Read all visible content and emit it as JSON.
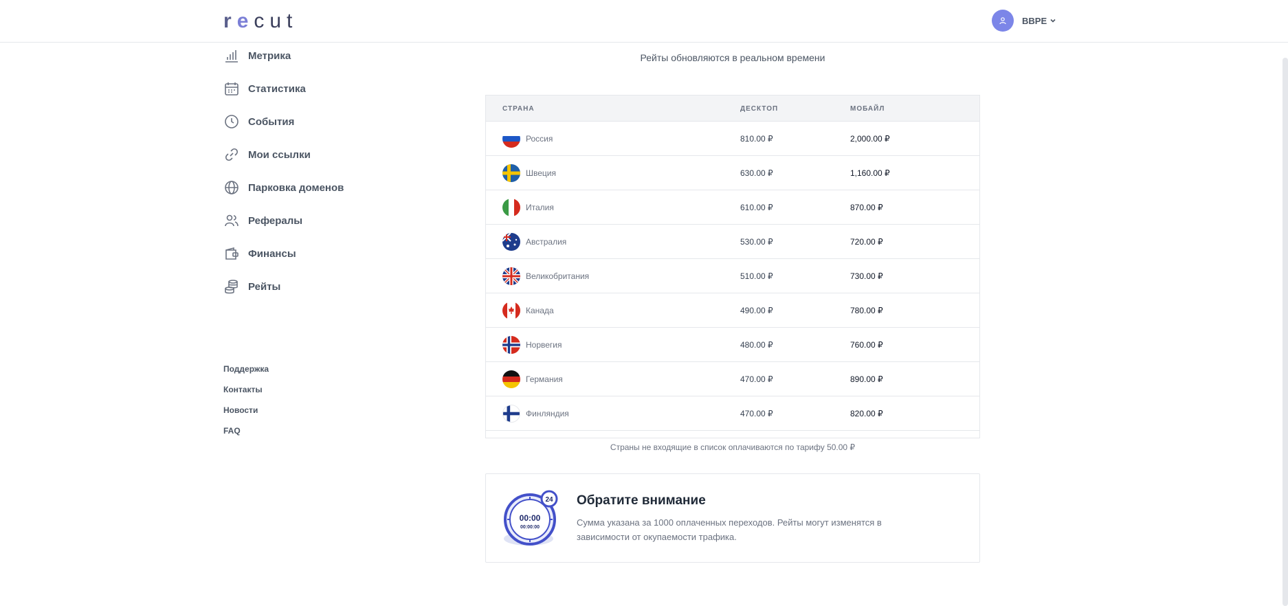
{
  "header": {
    "logo": [
      "r",
      "e",
      "cut"
    ],
    "user_name": "BBPE"
  },
  "sidebar": {
    "items": [
      {
        "label": "Метрика",
        "icon": "bar-chart-icon"
      },
      {
        "label": "Статистика",
        "icon": "calendar-icon"
      },
      {
        "label": "События",
        "icon": "clock-icon"
      },
      {
        "label": "Мои ссылки",
        "icon": "link-icon"
      },
      {
        "label": "Парковка доменов",
        "icon": "globe-icon"
      },
      {
        "label": "Рефералы",
        "icon": "users-icon"
      },
      {
        "label": "Финансы",
        "icon": "wallet-icon"
      },
      {
        "label": "Рейты",
        "icon": "coins-icon"
      }
    ],
    "footer_links": [
      "Поддержка",
      "Контакты",
      "Новости",
      "FAQ"
    ]
  },
  "main": {
    "subtitle": "Рейты обновляются в реальном времени",
    "table": {
      "columns": [
        "СТРАНА",
        "ДЕСКТОП",
        "МОБАЙЛ"
      ],
      "rows": [
        {
          "country": "Россия",
          "desktop": "810.00 ₽",
          "mobile": "2,000.00 ₽",
          "flag": "ru"
        },
        {
          "country": "Швеция",
          "desktop": "630.00 ₽",
          "mobile": "1,160.00 ₽",
          "flag": "se"
        },
        {
          "country": "Италия",
          "desktop": "610.00 ₽",
          "mobile": "870.00 ₽",
          "flag": "it"
        },
        {
          "country": "Австралия",
          "desktop": "530.00 ₽",
          "mobile": "720.00 ₽",
          "flag": "au"
        },
        {
          "country": "Великобритания",
          "desktop": "510.00 ₽",
          "mobile": "730.00 ₽",
          "flag": "gb"
        },
        {
          "country": "Канада",
          "desktop": "490.00 ₽",
          "mobile": "780.00 ₽",
          "flag": "ca"
        },
        {
          "country": "Норвегия",
          "desktop": "480.00 ₽",
          "mobile": "760.00 ₽",
          "flag": "no"
        },
        {
          "country": "Германия",
          "desktop": "470.00 ₽",
          "mobile": "890.00 ₽",
          "flag": "de"
        },
        {
          "country": "Финляндия",
          "desktop": "470.00 ₽",
          "mobile": "820.00 ₽",
          "flag": "fi"
        }
      ]
    },
    "note": "Страны не входящие в список оплачиваются по тарифу 50.00 ₽",
    "notice": {
      "title": "Обратите внимание",
      "text": "Сумма указана за 1000 оплаченных переходов. Рейты могут изменятся в зависимости от окупаемости трафика.",
      "illustration": {
        "badge": "24",
        "time": "00:00",
        "time_small": "00:00:00"
      }
    }
  },
  "colors": {
    "accent": "#7c86e8",
    "border": "#e5e7eb",
    "header_bg": "#f3f4f6"
  }
}
